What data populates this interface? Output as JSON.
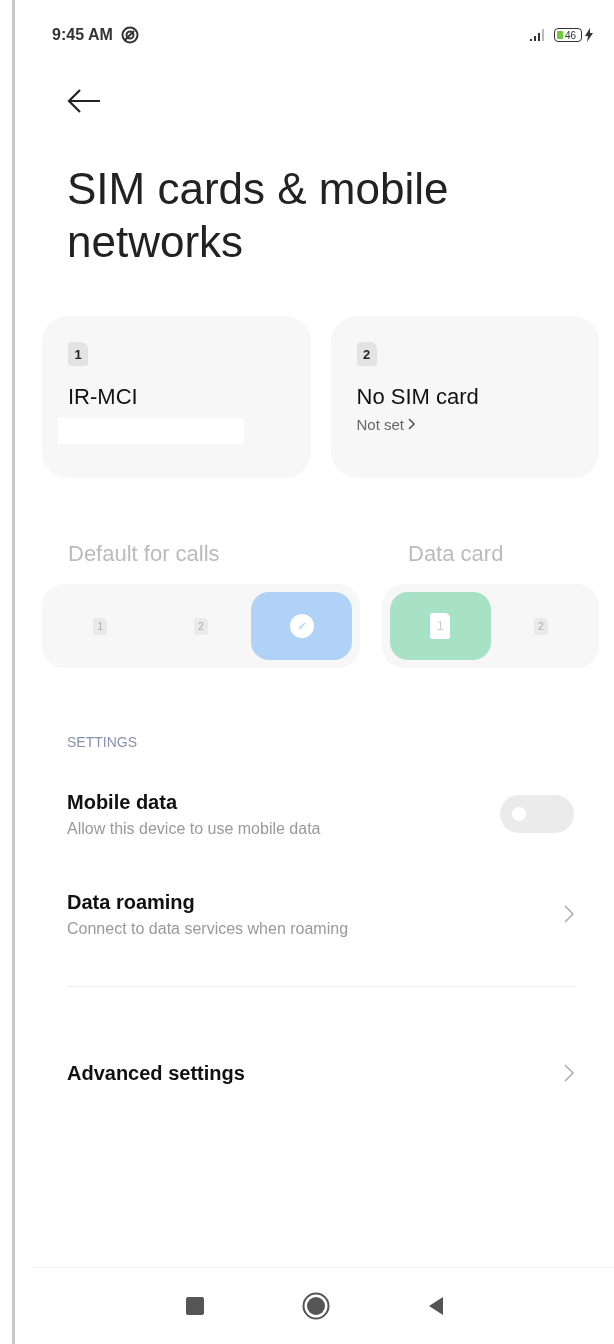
{
  "status_bar": {
    "time": "9:45 AM",
    "battery": "46"
  },
  "title": "SIM cards & mobile networks",
  "sim_cards": [
    {
      "number": "1",
      "name": "IR-MCI"
    },
    {
      "number": "2",
      "name": "No SIM card",
      "status": "Not set"
    }
  ],
  "default_for_calls": {
    "label": "Default for calls",
    "options": [
      {
        "kind": "sim",
        "number": "1",
        "selected": false
      },
      {
        "kind": "sim",
        "number": "2",
        "selected": false
      },
      {
        "kind": "ask",
        "selected": true
      }
    ]
  },
  "data_card": {
    "label": "Data card",
    "options": [
      {
        "kind": "sim",
        "number": "1",
        "selected": true
      },
      {
        "kind": "sim",
        "number": "2",
        "selected": false
      }
    ]
  },
  "section_header": "SETTINGS",
  "settings_groups": [
    [
      {
        "kind": "toggle",
        "title": "Mobile data",
        "subtitle": "Allow this device to use mobile data",
        "on": false
      },
      {
        "kind": "link",
        "title": "Data roaming",
        "subtitle": "Connect to data services when roaming"
      }
    ],
    [
      {
        "kind": "link",
        "title": "Advanced settings"
      }
    ]
  ]
}
